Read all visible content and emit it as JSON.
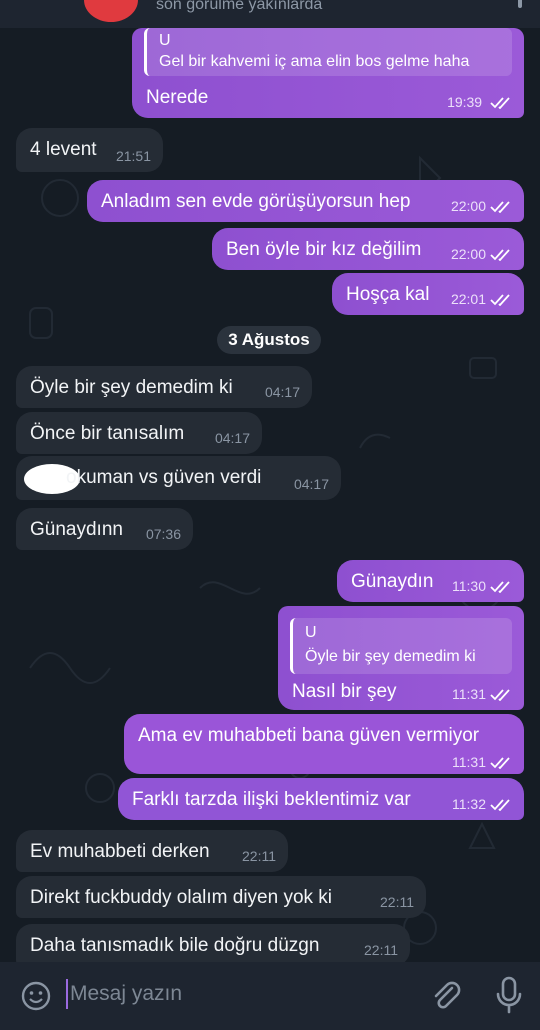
{
  "header": {
    "status": "son görülme yakınlarda",
    "avatar_color": "#e03a3f"
  },
  "colors": {
    "outgoing_bubble": "#9457d4",
    "incoming_bubble": "#252c35",
    "background": "#151c24"
  },
  "messages": [
    {
      "dir": "out",
      "reply_name": "U",
      "reply_text": "Gel bir kahvemi iç ama elin bos gelme haha",
      "text": "Nerede",
      "time": "19:39",
      "read": true
    },
    {
      "dir": "in",
      "text": "4 levent",
      "time": "21:51"
    },
    {
      "dir": "out",
      "text": "Anladım sen evde görüşüyorsun hep",
      "time": "22:00",
      "read": true
    },
    {
      "dir": "out",
      "text": "Ben öyle bir kız değilim",
      "time": "22:00",
      "read": true
    },
    {
      "dir": "out",
      "text": "Hoşça kal",
      "time": "22:01",
      "read": true
    },
    {
      "dir": "in",
      "text": "Öyle bir şey demedim ki",
      "time": "04:17"
    },
    {
      "dir": "in",
      "text": "Önce bir tanısalım",
      "time": "04:17"
    },
    {
      "dir": "in",
      "text": "okuman vs güven verdi",
      "time": "04:17",
      "redacted_prefix": true
    },
    {
      "dir": "in",
      "text": "Günaydınn",
      "time": "07:36"
    },
    {
      "dir": "out",
      "text": "Günaydın",
      "time": "11:30",
      "read": true
    },
    {
      "dir": "out",
      "reply_name": "U",
      "reply_text": "Öyle bir şey demedim ki",
      "text": "Nasıl bir şey",
      "time": "11:31",
      "read": true
    },
    {
      "dir": "out",
      "text": "Ama ev muhabbeti bana güven vermiyor",
      "time": "11:31",
      "read": true
    },
    {
      "dir": "out",
      "text": "Farklı tarzda ilişki beklentimiz var",
      "time": "11:32",
      "read": true
    },
    {
      "dir": "in",
      "text": "Ev muhabbeti derken",
      "time": "22:11"
    },
    {
      "dir": "in",
      "text": "Direkt fuckbuddy olalım diyen yok ki",
      "time": "22:11"
    },
    {
      "dir": "in",
      "text": "Daha tanısmadık bile doğru düzgn",
      "time": "22:11"
    }
  ],
  "date_separator": "3 Ağustos",
  "input": {
    "placeholder": "Mesaj yazın"
  },
  "icons": {
    "emoji": "emoji-icon",
    "attach": "paperclip-icon",
    "mic": "microphone-icon",
    "read": "double-check-icon"
  }
}
